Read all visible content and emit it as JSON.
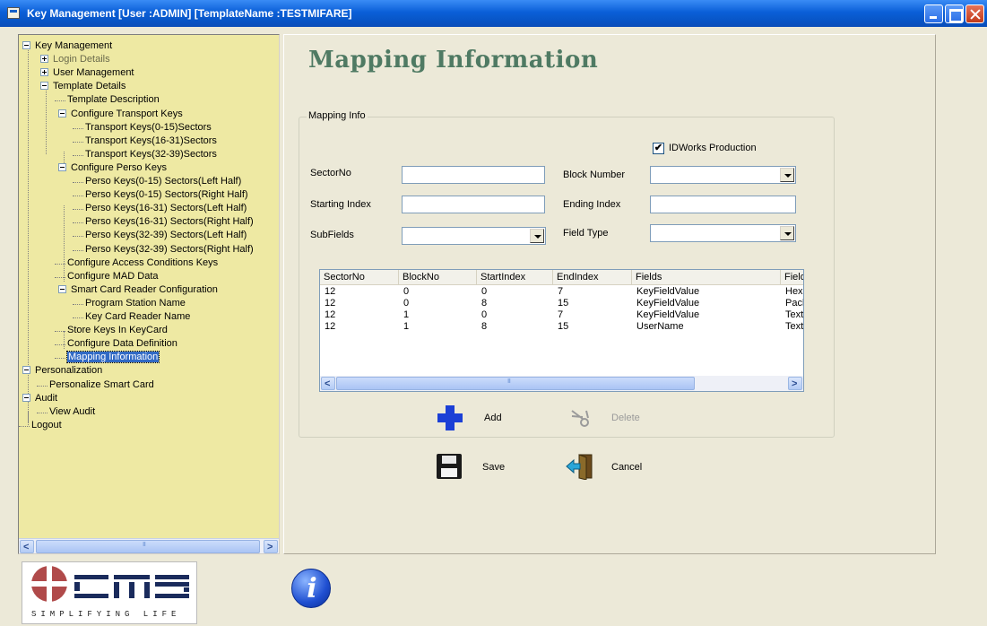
{
  "window": {
    "title": "Key Management [User :ADMIN] [TemplateName :TESTMIFARE]"
  },
  "tree": {
    "nodes": [
      {
        "label": "Key Management",
        "expander": "minus"
      },
      {
        "label": "Login Details",
        "expander": "plus",
        "disabled": true
      },
      {
        "label": "User Management",
        "expander": "plus"
      },
      {
        "label": "Template Details",
        "expander": "minus"
      },
      {
        "label": "Template Description"
      },
      {
        "label": "Configure Transport Keys",
        "expander": "minus"
      },
      {
        "label": "Transport Keys(0-15)Sectors"
      },
      {
        "label": "Transport Keys(16-31)Sectors"
      },
      {
        "label": "Transport Keys(32-39)Sectors"
      },
      {
        "label": "Configure Perso Keys",
        "expander": "minus"
      },
      {
        "label": "Perso Keys(0-15) Sectors(Left Half)"
      },
      {
        "label": "Perso Keys(0-15) Sectors(Right Half)"
      },
      {
        "label": "Perso Keys(16-31) Sectors(Left Half)"
      },
      {
        "label": "Perso Keys(16-31) Sectors(Right Half)"
      },
      {
        "label": "Perso Keys(32-39) Sectors(Left Half)"
      },
      {
        "label": "Perso Keys(32-39) Sectors(Right Half)"
      },
      {
        "label": "Configure Access Conditions Keys"
      },
      {
        "label": "Configure MAD Data"
      },
      {
        "label": "Smart Card Reader Configuration",
        "expander": "minus"
      },
      {
        "label": "Program Station Name"
      },
      {
        "label": "Key Card Reader Name"
      },
      {
        "label": "Store Keys In KeyCard"
      },
      {
        "label": "Configure Data Definition"
      },
      {
        "label": "Mapping Information",
        "selected": true
      },
      {
        "label": "Personalization",
        "expander": "minus"
      },
      {
        "label": "Personalize Smart Card"
      },
      {
        "label": "Audit",
        "expander": "minus"
      },
      {
        "label": "View Audit"
      },
      {
        "label": "Logout"
      }
    ]
  },
  "main": {
    "page_title": "Mapping Information",
    "group_title": "Mapping Info",
    "idworks_checkbox": {
      "label": "IDWorks Production",
      "checked": true,
      "mark": "✔"
    },
    "fields": {
      "sector_no": {
        "label": "SectorNo",
        "value": ""
      },
      "block_number": {
        "label": "Block Number",
        "value": ""
      },
      "starting_index": {
        "label": "Starting Index",
        "value": ""
      },
      "ending_index": {
        "label": "Ending Index",
        "value": ""
      },
      "subfields": {
        "label": "SubFields",
        "value": ""
      },
      "field_type": {
        "label": "Field Type",
        "value": ""
      }
    },
    "table": {
      "columns": [
        "SectorNo",
        "BlockNo",
        "StartIndex",
        "EndIndex",
        "Fields",
        "Field"
      ],
      "rows": [
        [
          "12",
          "0",
          "0",
          "7",
          "KeyFieldValue",
          "Hex"
        ],
        [
          "12",
          "0",
          "8",
          "15",
          "KeyFieldValue",
          "Pack"
        ],
        [
          "12",
          "1",
          "0",
          "7",
          "KeyFieldValue",
          "Text"
        ],
        [
          "12",
          "1",
          "8",
          "15",
          "UserName",
          "Text"
        ]
      ]
    },
    "actions": {
      "add": "Add",
      "delete": "Delete",
      "save": "Save",
      "cancel": "Cancel"
    }
  },
  "footer": {
    "logo_text": "SIMPLIFYING LIFE",
    "info_glyph": "i"
  },
  "colors": {
    "tree_background": "#eee9a3",
    "title_accent": "#4f7a63",
    "selection": "#316ac5",
    "add_icon": "#1b3fd6"
  }
}
